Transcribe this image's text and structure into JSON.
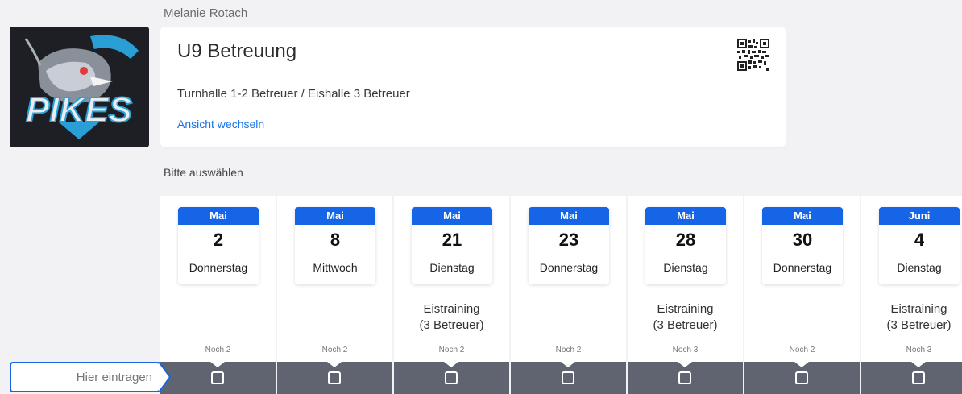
{
  "user": {
    "name": "Melanie Rotach"
  },
  "event": {
    "title": "U9 Betreuung",
    "description": "Turnhalle 1-2 Betreuer / Eishalle 3 Betreuer",
    "view_toggle": "Ansicht wechseln"
  },
  "logo": {
    "text": "PIKES"
  },
  "prompt": "Bitte auswählen",
  "input": {
    "placeholder": "Hier eintragen",
    "value": ""
  },
  "dates": [
    {
      "month": "Mai",
      "day": "2",
      "weekday": "Donnerstag",
      "note_line1": "",
      "note_line2": "",
      "remaining": "Noch 2"
    },
    {
      "month": "Mai",
      "day": "8",
      "weekday": "Mittwoch",
      "note_line1": "",
      "note_line2": "",
      "remaining": "Noch 2"
    },
    {
      "month": "Mai",
      "day": "21",
      "weekday": "Dienstag",
      "note_line1": "Eistraining",
      "note_line2": "(3 Betreuer)",
      "remaining": "Noch 2"
    },
    {
      "month": "Mai",
      "day": "23",
      "weekday": "Donnerstag",
      "note_line1": "",
      "note_line2": "",
      "remaining": "Noch 2"
    },
    {
      "month": "Mai",
      "day": "28",
      "weekday": "Dienstag",
      "note_line1": "Eistraining",
      "note_line2": "(3 Betreuer)",
      "remaining": "Noch 3"
    },
    {
      "month": "Mai",
      "day": "30",
      "weekday": "Donnerstag",
      "note_line1": "",
      "note_line2": "",
      "remaining": "Noch 2"
    },
    {
      "month": "Juni",
      "day": "4",
      "weekday": "Dienstag",
      "note_line1": "Eistraining",
      "note_line2": "(3 Betreuer)",
      "remaining": "Noch 3"
    }
  ],
  "colors": {
    "accent": "#1565e6",
    "link": "#1a73e8",
    "row_dark": "#5f6470"
  }
}
